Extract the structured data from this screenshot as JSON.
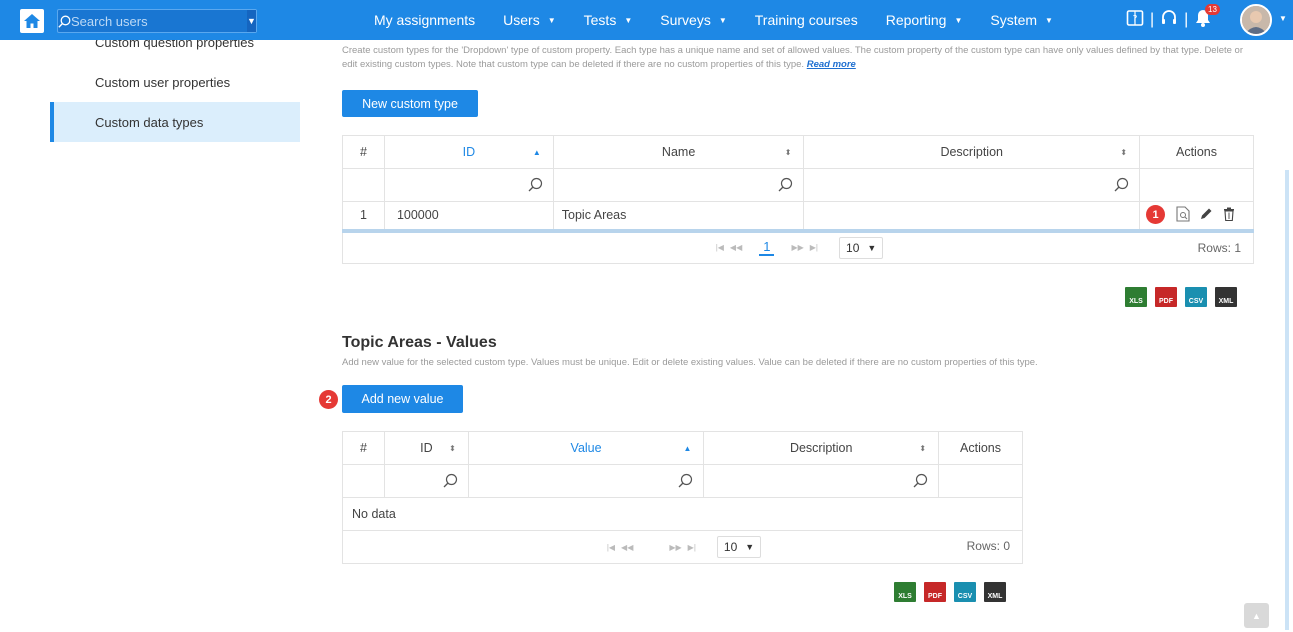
{
  "header": {
    "search_placeholder": "Search users",
    "nav": [
      {
        "label": "My assignments",
        "dropdown": false
      },
      {
        "label": "Users",
        "dropdown": true
      },
      {
        "label": "Tests",
        "dropdown": true
      },
      {
        "label": "Surveys",
        "dropdown": true
      },
      {
        "label": "Training courses",
        "dropdown": false
      },
      {
        "label": "Reporting",
        "dropdown": true
      },
      {
        "label": "System",
        "dropdown": true
      }
    ],
    "notification_count": "13"
  },
  "sidebar": {
    "items": [
      {
        "label": "Custom question properties"
      },
      {
        "label": "Custom user properties"
      },
      {
        "label": "Custom data types"
      }
    ]
  },
  "custom_types": {
    "description": "Create custom types for the 'Dropdown' type of custom property. Each type has a unique name and set of allowed values. The custom property of the custom type can have only values defined by that type. Delete or edit existing custom types. Note that custom type can be deleted if there are no custom properties of this type.",
    "read_more": "Read more",
    "new_button": "New custom type",
    "columns": [
      "#",
      "ID",
      "Name",
      "Description",
      "Actions"
    ],
    "rows": [
      {
        "num": "1",
        "id": "100000",
        "name": "Topic Areas",
        "description": ""
      }
    ],
    "page": "1",
    "page_size": "10",
    "rows_label": "Rows: 1"
  },
  "values": {
    "title": "Topic Areas - Values",
    "description": "Add new value for the selected custom type. Values must be unique. Edit or delete existing values. Value can be deleted if there are no custom properties of this type.",
    "add_button": "Add new value",
    "columns": [
      "#",
      "ID",
      "Value",
      "Description",
      "Actions"
    ],
    "empty_text": "No data",
    "page_size": "10",
    "rows_label": "Rows: 0"
  },
  "steps": {
    "one": "1",
    "two": "2"
  },
  "export": [
    "XLS",
    "PDF",
    "CSV",
    "XML"
  ],
  "colors": {
    "primary": "#1e88e5",
    "step": "#e53935",
    "xls": "#2e7d32",
    "pdf": "#c62828",
    "csv": "#1a8fb0",
    "xml": "#333333"
  }
}
